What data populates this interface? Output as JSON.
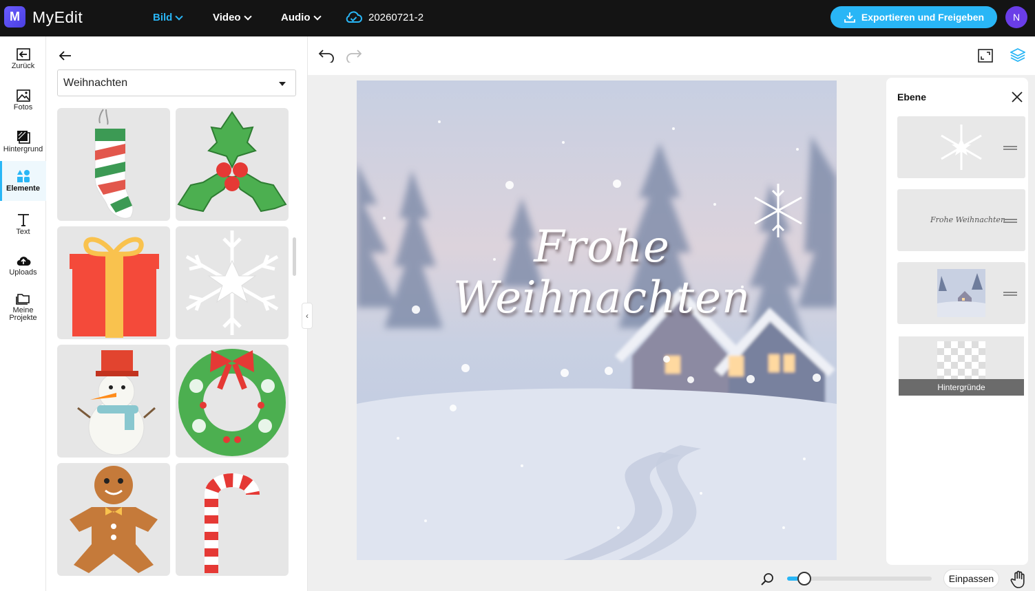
{
  "app": {
    "logo_letter": "M",
    "brand": "MyEdit",
    "project_name": "20260721-2",
    "export_label": "Exportieren und Freigeben",
    "avatar_initial": "N",
    "accent_color": "#29b6f6"
  },
  "nav": [
    {
      "label": "Bild",
      "active": true
    },
    {
      "label": "Video",
      "active": false
    },
    {
      "label": "Audio",
      "active": false
    }
  ],
  "rail": [
    {
      "label": "Zurück",
      "icon": "back-arrow-icon"
    },
    {
      "label": "Fotos",
      "icon": "photo-icon"
    },
    {
      "label": "Hintergrund",
      "icon": "background-icon"
    },
    {
      "label": "Elemente",
      "icon": "elements-icon",
      "active": true
    },
    {
      "label": "Text",
      "icon": "text-icon"
    },
    {
      "label": "Uploads",
      "icon": "upload-cloud-icon"
    },
    {
      "label": "Meine Projekte",
      "icon": "folder-icon"
    }
  ],
  "panel": {
    "category": "Weihnachten",
    "elements": [
      "stocking",
      "holly",
      "gift",
      "snowflake",
      "snowman",
      "wreath",
      "gingerbread",
      "candy-cane"
    ]
  },
  "canvas": {
    "greeting": "Frohe Weihnachten"
  },
  "layers": {
    "title": "Ebene",
    "mini_text": "Frohe Weihnachten",
    "backgrounds_label": "Hintergründe"
  },
  "zoom": {
    "level": 0.08,
    "fit_label": "Einpassen"
  }
}
